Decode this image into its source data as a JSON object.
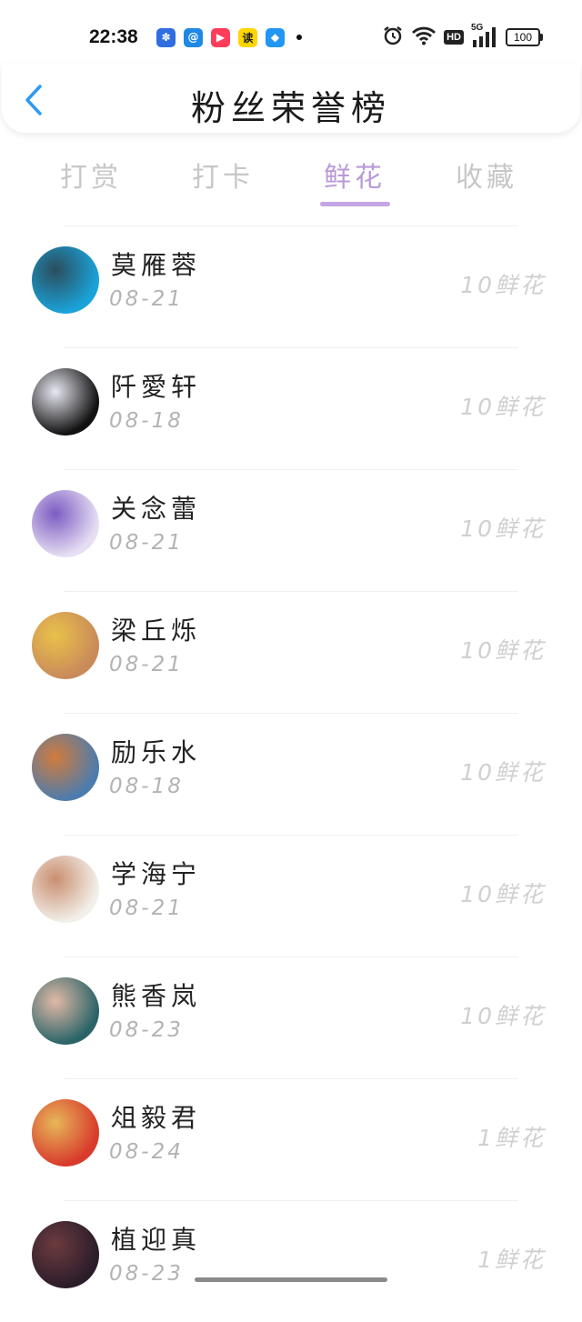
{
  "status_bar": {
    "time": "22:38",
    "app_icons": [
      {
        "icon": "baidu-paw-icon",
        "glyph": "✽",
        "color": "#2f6de1"
      },
      {
        "icon": "qq-browser-icon",
        "glyph": "@",
        "color": "#1e88e5"
      },
      {
        "icon": "video-play-icon",
        "glyph": "▶",
        "color": "#ff3d5a"
      },
      {
        "icon": "read-app-icon",
        "glyph": "读",
        "color": "#ffd600"
      },
      {
        "icon": "leaf-app-icon",
        "glyph": "◆",
        "color": "#2196f3"
      }
    ],
    "hd": "HD",
    "network": "5G",
    "battery": "100"
  },
  "header": {
    "title": "粉丝荣誉榜"
  },
  "tabs": [
    {
      "label": "打赏",
      "active": false
    },
    {
      "label": "打卡",
      "active": false
    },
    {
      "label": "鲜花",
      "active": true
    },
    {
      "label": "收藏",
      "active": false
    }
  ],
  "fans": [
    {
      "name": "莫雁蓉",
      "date": "08-21",
      "amount": "10鲜花",
      "avatar": "avatar-ocean-icon",
      "colors": [
        "#1aa3d9",
        "#2b4d5c"
      ]
    },
    {
      "name": "阡愛轩",
      "date": "08-18",
      "amount": "10鲜花",
      "avatar": "avatar-portrait-icon",
      "colors": [
        "#111111",
        "#e8e8f2"
      ]
    },
    {
      "name": "关念蕾",
      "date": "08-21",
      "amount": "10鲜花",
      "avatar": "avatar-anime-girl-icon",
      "colors": [
        "#e7def3",
        "#7b5cc2"
      ]
    },
    {
      "name": "梁丘烁",
      "date": "08-21",
      "amount": "10鲜花",
      "avatar": "avatar-hamster-icon",
      "colors": [
        "#c98a5a",
        "#e9c14a"
      ]
    },
    {
      "name": "励乐水",
      "date": "08-18",
      "amount": "10鲜花",
      "avatar": "avatar-city-sunset-icon",
      "colors": [
        "#4c7cae",
        "#d27b3c"
      ]
    },
    {
      "name": "学海宁",
      "date": "08-21",
      "amount": "10鲜花",
      "avatar": "avatar-cartoon-icon",
      "colors": [
        "#f2efe9",
        "#c98f70"
      ]
    },
    {
      "name": "熊香岚",
      "date": "08-23",
      "amount": "10鲜花",
      "avatar": "avatar-woman-icon",
      "colors": [
        "#2a6468",
        "#e2b9a6"
      ]
    },
    {
      "name": "俎毅君",
      "date": "08-24",
      "amount": "1鲜花",
      "avatar": "avatar-sunglasses-icon",
      "colors": [
        "#d83a2b",
        "#e7b75a"
      ]
    },
    {
      "name": "植迎真",
      "date": "08-23",
      "amount": "1鲜花",
      "avatar": "avatar-night-forest-icon",
      "colors": [
        "#2b1d2a",
        "#6c3b3f"
      ]
    }
  ]
}
